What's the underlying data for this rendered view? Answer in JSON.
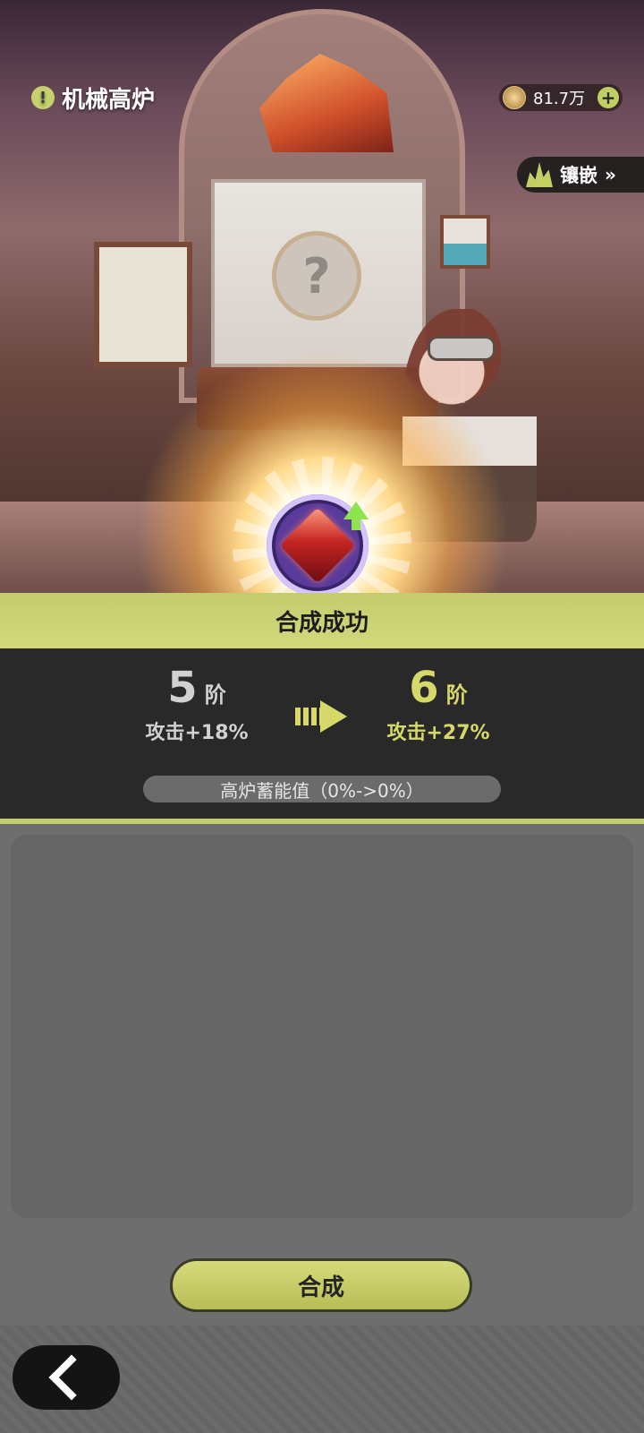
{
  "header": {
    "title": "机械高炉",
    "currency_amount": "81.7万",
    "inlay_label": "镶嵌"
  },
  "result": {
    "banner": "合成成功",
    "from": {
      "level": "5",
      "unit": "阶",
      "attribute": "攻击+18%"
    },
    "to": {
      "level": "6",
      "unit": "阶",
      "attribute": "攻击+27%"
    },
    "energy_text": "高炉蓄能值（0%->0%）"
  },
  "actions": {
    "compose_label": "合成"
  },
  "icons": {
    "warning": "warning-icon",
    "coin": "coin-icon",
    "plus": "plus-icon",
    "crystal": "crystal-icon",
    "gem": "red-gem-icon",
    "back": "back-arrow-icon"
  },
  "colors": {
    "accent": "#C4CC70",
    "panel": "#292929",
    "new_level": "#D7D86A"
  }
}
